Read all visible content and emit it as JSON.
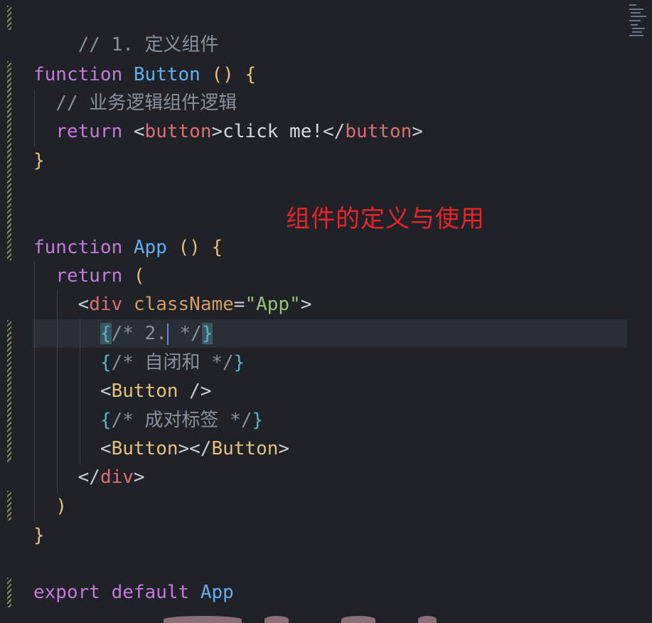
{
  "editor": {
    "overlay_caption": "组件的定义与使用",
    "lines": {
      "l1_comment": "// 1. 定义组件",
      "l2_kw": "function",
      "l2_name": "Button",
      "l2_parens": "()",
      "l2_brace": "{",
      "l3_comment": "// 业务逻辑组件逻辑",
      "l4_kw": "return",
      "l4_lt1": "<",
      "l4_tag1": "button",
      "l4_gt1": ">",
      "l4_text": "click me!",
      "l4_lt2": "</",
      "l4_tag2": "button",
      "l4_gt2": ">",
      "l5_brace": "}",
      "l7_kw": "function",
      "l7_name": "App",
      "l7_parens": "()",
      "l7_brace": "{",
      "l8_kw": "return",
      "l8_paren": "(",
      "l9_lt": "<",
      "l9_tag": "div",
      "l9_attr": "className",
      "l9_eq": "=",
      "l9_str": "\"App\"",
      "l9_gt": ">",
      "l10_open": "{",
      "l10_comment_a": "/* 2.",
      "l10_comment_b": " */",
      "l10_close": "}",
      "l11_open": "{",
      "l11_comment": "/* 自闭和 */",
      "l11_close": "}",
      "l12_lt": "<",
      "l12_comp": "Button",
      "l12_end": " />",
      "l13_open": "{",
      "l13_comment": "/* 成对标签 */",
      "l13_close": "}",
      "l14_lt1": "<",
      "l14_comp1": "Button",
      "l14_gt1": ">",
      "l14_lt2": "</",
      "l14_comp2": "Button",
      "l14_gt2": ">",
      "l15_lt": "</",
      "l15_tag": "div",
      "l15_gt": ">",
      "l16_paren": ")",
      "l17_brace": "}",
      "l19_kw1": "export",
      "l19_kw2": "default",
      "l19_name": "App"
    }
  },
  "colors": {
    "background": "#1f2227",
    "keyword": "#c678dd",
    "function_name": "#61afef",
    "jsx_tag": "#e06c75",
    "component": "#e5c07b",
    "string": "#98c379",
    "caption_red": "#e8252b"
  }
}
